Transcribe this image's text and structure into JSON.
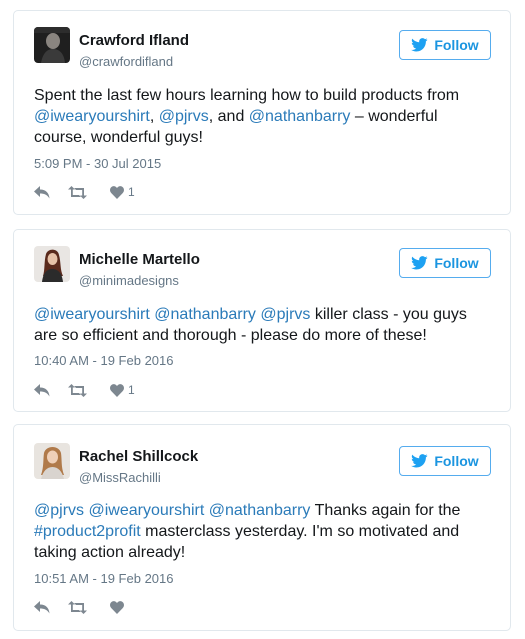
{
  "colors": {
    "accent": "#1b95e0",
    "link": "#2b7bb9",
    "muted": "#657786",
    "icon": "#7d8790"
  },
  "tweets": [
    {
      "name": "Crawford Ifland",
      "handle": "@crawfordifland",
      "follow_label": "Follow",
      "text": [
        {
          "t": "Spent the last few hours learning how to build products from "
        },
        {
          "t": "@iwearyourshirt",
          "link": true
        },
        {
          "t": ", "
        },
        {
          "t": "@pjrvs",
          "link": true
        },
        {
          "t": ", and "
        },
        {
          "t": "@nathanbarry",
          "link": true
        },
        {
          "t": " – wonderful course, wonderful guys!"
        }
      ],
      "timestamp": "5:09 PM - 30 Jul 2015",
      "like_count": "1",
      "avatar_icon": "man-portrait-avatar"
    },
    {
      "name": "Michelle Martello",
      "handle": "@minimadesigns",
      "follow_label": "Follow",
      "text": [
        {
          "t": "@iwearyourshirt",
          "link": true
        },
        {
          "t": " "
        },
        {
          "t": "@nathanbarry",
          "link": true
        },
        {
          "t": " "
        },
        {
          "t": "@pjrvs",
          "link": true
        },
        {
          "t": " killer class - you guys are so efficient and thorough - please do more of these!"
        }
      ],
      "timestamp": "10:40 AM - 19 Feb 2016",
      "like_count": "1",
      "avatar_icon": "woman-portrait-avatar"
    },
    {
      "name": "Rachel Shillcock",
      "handle": "@MissRachilli",
      "follow_label": "Follow",
      "text": [
        {
          "t": "@pjrvs",
          "link": true
        },
        {
          "t": " "
        },
        {
          "t": "@iwearyourshirt",
          "link": true
        },
        {
          "t": " "
        },
        {
          "t": "@nathanbarry",
          "link": true
        },
        {
          "t": " Thanks again for the "
        },
        {
          "t": "#product2profit",
          "link": true
        },
        {
          "t": " masterclass yesterday. I'm so motivated and taking action already!"
        }
      ],
      "timestamp": "10:51 AM - 19 Feb 2016",
      "like_count": "",
      "avatar_icon": "woman-portrait-avatar"
    }
  ]
}
